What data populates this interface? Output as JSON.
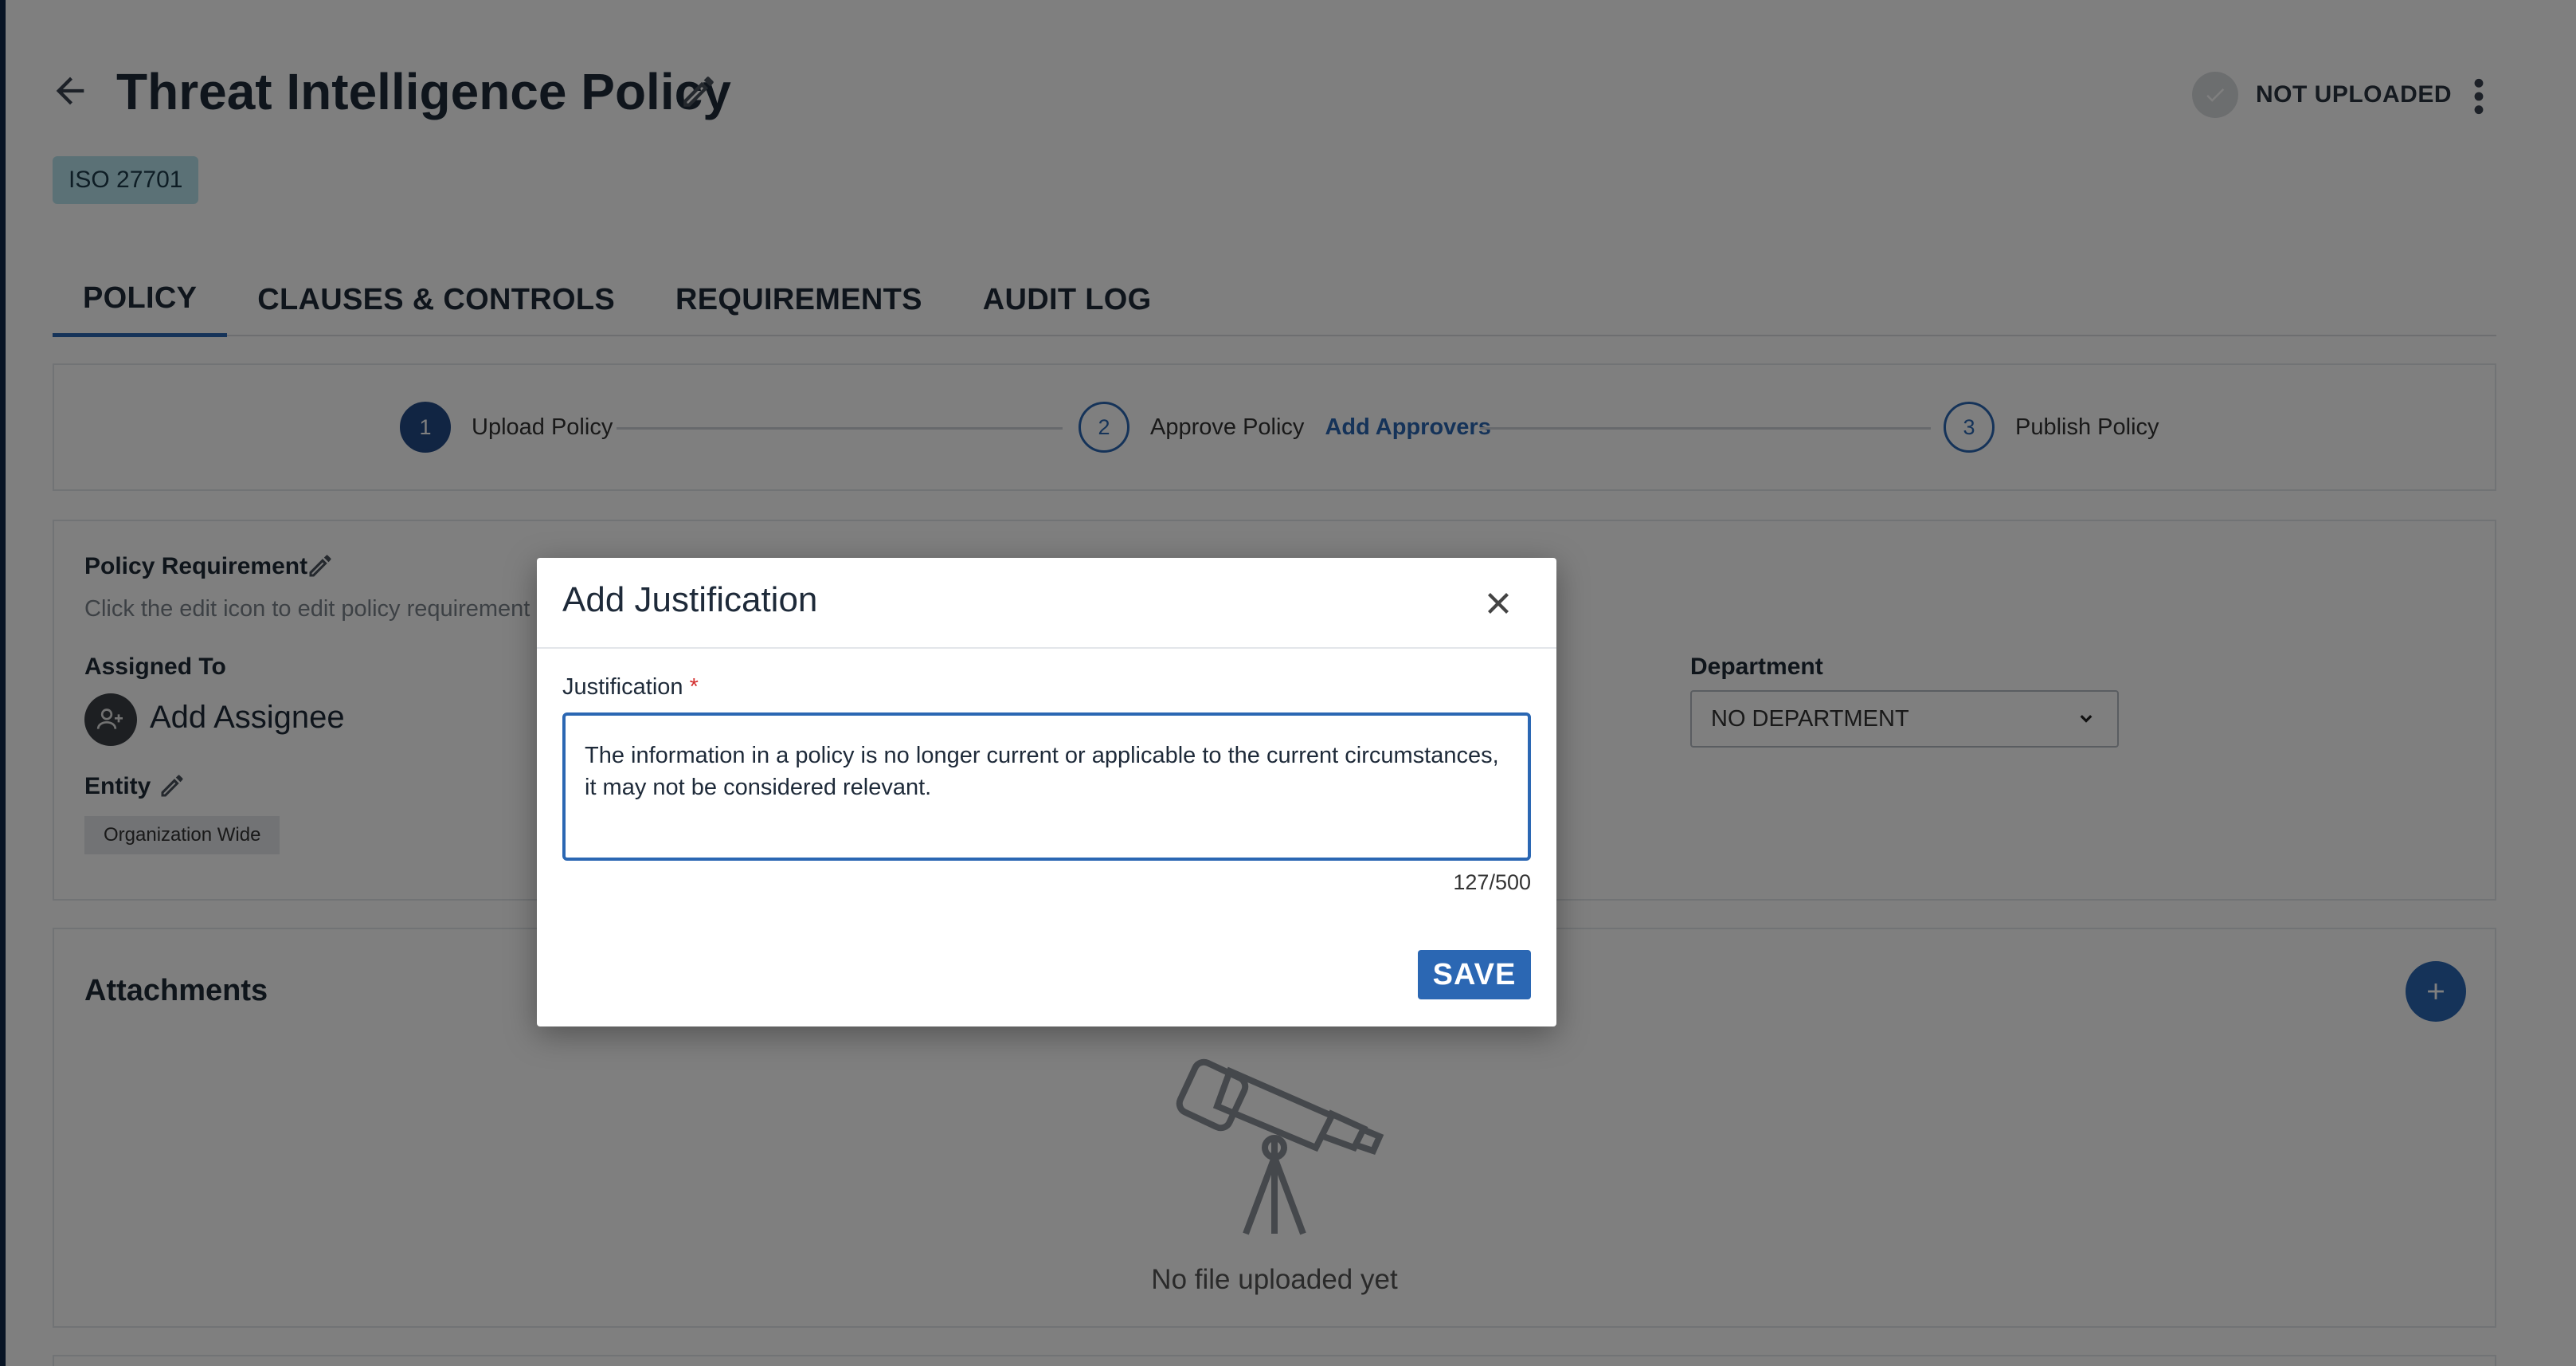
{
  "header": {
    "title": "Threat Intelligence Policy",
    "status": "NOT UPLOADED",
    "tag": "ISO 27701"
  },
  "tabs": [
    {
      "label": "POLICY",
      "active": true
    },
    {
      "label": "CLAUSES & CONTROLS",
      "active": false
    },
    {
      "label": "REQUIREMENTS",
      "active": false
    },
    {
      "label": "AUDIT LOG",
      "active": false
    }
  ],
  "steps": [
    {
      "num": "1",
      "label": "Upload Policy",
      "done": true
    },
    {
      "num": "2",
      "label": "Approve Policy",
      "link": "Add Approvers",
      "done": false
    },
    {
      "num": "3",
      "label": "Publish Policy",
      "done": false
    }
  ],
  "requirement": {
    "title": "Policy Requirement",
    "hint": "Click the edit icon to edit policy requirement",
    "assigned_label": "Assigned To",
    "assign_action": "Add Assignee",
    "entity_label": "Entity",
    "entity_value": "Organization Wide",
    "department_label": "Department",
    "department_value": "NO DEPARTMENT"
  },
  "attachments": {
    "title": "Attachments",
    "empty_text": "No file uploaded yet"
  },
  "modal": {
    "title": "Add Justification",
    "field_label": "Justification",
    "required_mark": "*",
    "value": "The information in a policy is no longer current or applicable to the current circumstances, it may not be considered relevant.",
    "counter": "127/500",
    "save_label": "SAVE"
  },
  "colors": {
    "accent": "#2b67b3",
    "step_done": "#234a86",
    "tag_bg": "#b7e2ec",
    "overlay": "rgba(0,0,0,0.5)"
  }
}
